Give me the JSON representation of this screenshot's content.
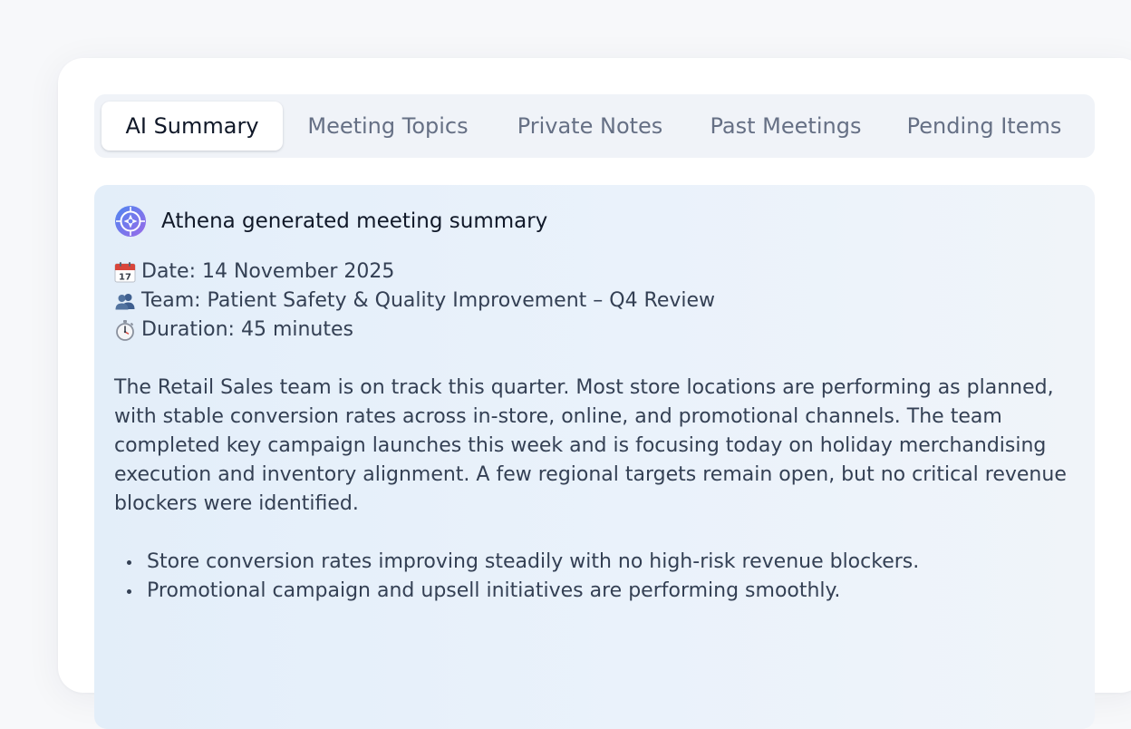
{
  "tabs": [
    {
      "label": "AI Summary",
      "active": true
    },
    {
      "label": "Meeting Topics",
      "active": false
    },
    {
      "label": "Private Notes",
      "active": false
    },
    {
      "label": "Past Meetings",
      "active": false
    },
    {
      "label": "Pending Items",
      "active": false
    }
  ],
  "summary": {
    "logo_icon": "athena-logo-icon",
    "title": "Athena generated meeting summary",
    "meta": [
      {
        "icon": "calendar-icon",
        "text": "Date: 14 November 2025"
      },
      {
        "icon": "team-icon",
        "text": "Team: Patient Safety & Quality Improvement – Q4 Review"
      },
      {
        "icon": "stopwatch-icon",
        "text": "Duration: 45 minutes"
      }
    ],
    "paragraph": "The Retail Sales team is on track this quarter. Most store locations are performing as planned, with stable conversion rates across in-store, online, and promotional channels. The team completed key campaign launches this week and is focusing today on holiday merchandising execution and inventory alignment. A few regional targets remain open, but no critical revenue blockers were identified.",
    "bullets": [
      "Store conversion rates improving steadily with no high-risk revenue blockers.",
      "Promotional campaign and upsell initiatives are performing smoothly."
    ]
  },
  "colors": {
    "active_tab_text": "#101828",
    "inactive_tab_text": "#667085",
    "tab_bar_bg": "#f0f3f8",
    "panel_bg_start": "#e3eef9",
    "body_text": "#344054",
    "logo_gradient_start": "#4f7cf0",
    "logo_gradient_end": "#9b6ae6"
  }
}
